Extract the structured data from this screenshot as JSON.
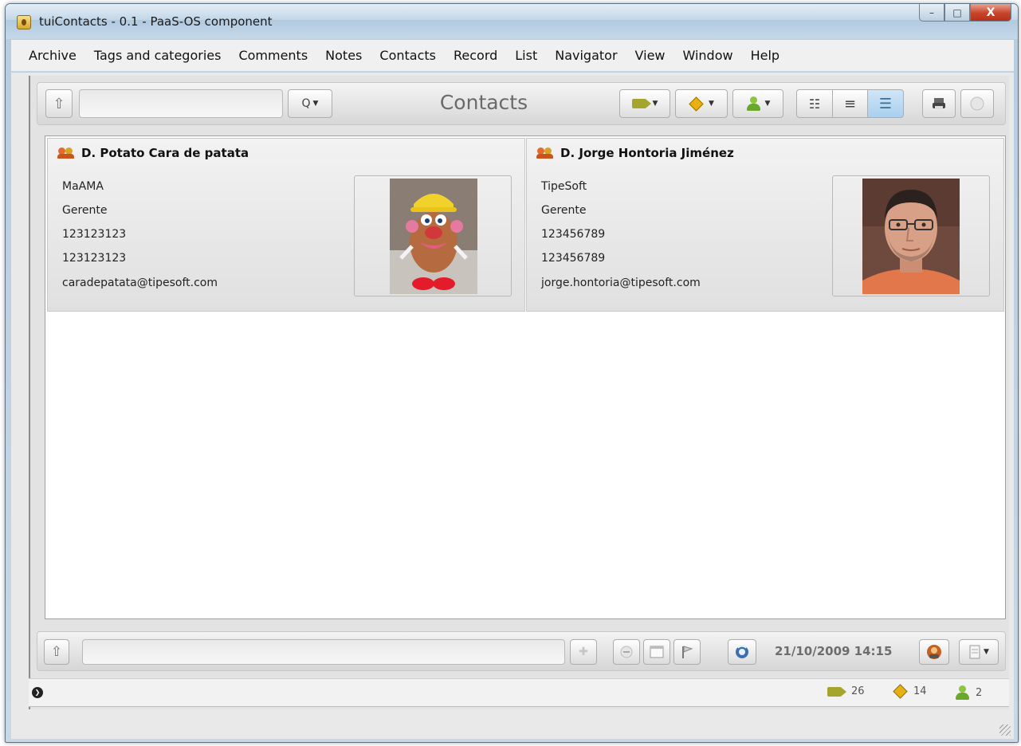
{
  "window": {
    "title": "tuiContacts - 0.1 - PaaS-OS component",
    "buttons": {
      "minimize": "–",
      "maximize": "□",
      "close": "X"
    }
  },
  "menu": {
    "items": [
      "Archive",
      "Tags and categories",
      "Comments",
      "Notes",
      "Contacts",
      "Record",
      "List",
      "Navigator",
      "View",
      "Window",
      "Help"
    ]
  },
  "toolbar": {
    "up_icon": "⇧",
    "search_placeholder": "",
    "search_icon": "Q",
    "title": "Contacts",
    "view_icons": {
      "icons_view": "☷",
      "list_view": "≡",
      "detail_view": "☰"
    }
  },
  "contacts": [
    {
      "name": "D. Potato Cara de patata",
      "company": "MaAMA",
      "position": "Gerente",
      "phone1": "123123123",
      "phone2": "123123123",
      "email": "caradepatata@tipesoft.com",
      "photo": "mr-potato-head-photo"
    },
    {
      "name": "D. Jorge Hontoria Jiménez",
      "company": "TipeSoft",
      "position": "Gerente",
      "phone1": "123456789",
      "phone2": "123456789",
      "email": "jorge.hontoria@tipesoft.com",
      "photo": "man-portrait-photo"
    }
  ],
  "bottombar": {
    "datetime": "21/10/2009 14:15",
    "add_icon": "✚",
    "remove_icon": "−"
  },
  "statusbar": {
    "info_icon": "❯",
    "tags_count": "26",
    "categories_count": "14",
    "contacts_count": "2"
  },
  "colors": {
    "accent": "#8cc63e",
    "tag": "#a5a52e",
    "category": "#e8b112"
  }
}
